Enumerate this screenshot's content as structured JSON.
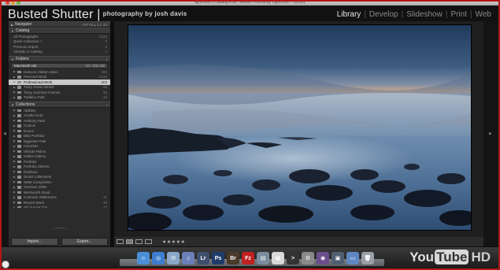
{
  "window": {
    "title": "lightroom 2 catalog.lrcat - Adobe Photoshop Lightroom - Library"
  },
  "identity_plate": {
    "name": "Busted Shutter |",
    "tagline": "photography by josh davis"
  },
  "modules": [
    "Library",
    "Develop",
    "Slideshow",
    "Print",
    "Web"
  ],
  "active_module": "Library",
  "left_panel": {
    "navigator": {
      "title": "Navigator",
      "zoom_options": "FIT FILL 1:1 3:1"
    },
    "catalog": {
      "title": "Catalog",
      "items": [
        {
          "label": "All Photographs",
          "count": "2165"
        },
        {
          "label": "Quick Collection +",
          "count": "0"
        },
        {
          "label": "Previous Import",
          "count": "4"
        },
        {
          "label": "Already in Catalog",
          "count": "1"
        }
      ]
    },
    "folders": {
      "title": "Folders",
      "volume": "Macintosh HD",
      "volume_info": "50 / 200 GB",
      "items": [
        {
          "label": "Halcyon Hidden Stars",
          "count": "355",
          "selected": false
        },
        {
          "label": "Personal Work",
          "count": "2143",
          "selected": false
        },
        {
          "label": "Professional Work",
          "count": "303",
          "selected": true
        },
        {
          "label": "Tracy Green Street",
          "count": "56",
          "selected": false
        },
        {
          "label": "Tracy Sunrises Frames",
          "count": "56",
          "selected": false
        },
        {
          "label": "Trafalco Park",
          "count": "15",
          "selected": false
        }
      ]
    },
    "collections": {
      "title": "Collections",
      "items": [
        {
          "label": "Abilities",
          "count": ""
        },
        {
          "label": "Acadia Hunt",
          "count": ""
        },
        {
          "label": "Anthony Park",
          "count": ""
        },
        {
          "label": "Cosmic",
          "count": ""
        },
        {
          "label": "Dunes",
          "count": ""
        },
        {
          "label": "DB2 Portfolio",
          "count": ""
        },
        {
          "label": "Eggestar Park",
          "count": ""
        },
        {
          "label": "Favorites",
          "count": ""
        },
        {
          "label": "Hillside Palms",
          "count": ""
        },
        {
          "label": "Online Gallery",
          "count": ""
        },
        {
          "label": "Portfolio",
          "count": ""
        },
        {
          "label": "Portfolio Selects",
          "count": ""
        },
        {
          "label": "Rainbow",
          "count": ""
        },
        {
          "label": "Smart Collections",
          "count": ""
        },
        {
          "label": "SMM Composites",
          "count": ""
        },
        {
          "label": "Sunrises 2009",
          "count": ""
        },
        {
          "label": "Wentworth Road",
          "count": ""
        },
        {
          "label": "Colorado Wilderness",
          "count": "41"
        },
        {
          "label": "Recent Work",
          "count": "29"
        },
        {
          "label": "Ski Sunset Trip",
          "count": "27"
        }
      ]
    },
    "import_button": "Import...",
    "export_button": "Export..."
  },
  "toolbar": {
    "rating": "★★★★★"
  },
  "dock_icons": [
    {
      "name": "finder-icon",
      "color": "#4a8fd6",
      "glyph": "☺"
    },
    {
      "name": "safari-icon",
      "color": "#3d7ed1",
      "glyph": "◎"
    },
    {
      "name": "mail-icon",
      "color": "#8aa7c9",
      "glyph": "✉"
    },
    {
      "name": "itunes-icon",
      "color": "#6b7fb8",
      "glyph": "♫"
    },
    {
      "name": "lightroom-icon",
      "color": "#3f4f6e",
      "glyph": "Lr"
    },
    {
      "name": "photoshop-icon",
      "color": "#1f3d6b",
      "glyph": "Ps"
    },
    {
      "name": "bridge-icon",
      "color": "#4b3a2a",
      "glyph": "Br"
    },
    {
      "name": "filezilla-icon",
      "color": "#c02020",
      "glyph": "Fz"
    },
    {
      "name": "preview-icon",
      "color": "#7a8c9e",
      "glyph": "▤"
    },
    {
      "name": "calendar-icon",
      "color": "#d8d8d8",
      "glyph": "▦"
    },
    {
      "name": "terminal-icon",
      "color": "#333",
      "glyph": ">"
    },
    {
      "name": "system-prefs-icon",
      "color": "#8a8a8a",
      "glyph": "⚙"
    },
    {
      "name": "photo-app-icon",
      "color": "#6b4e8c",
      "glyph": "◉"
    },
    {
      "name": "screen-icon",
      "color": "#505f72",
      "glyph": "▣"
    },
    {
      "name": "folder-icon",
      "color": "#5f87c2",
      "glyph": "▭"
    },
    {
      "name": "trash-icon",
      "color": "#9aa0a6",
      "glyph": "🗑"
    }
  ],
  "watermark": {
    "you": "You",
    "tube": "Tube",
    "hd": "HD"
  }
}
